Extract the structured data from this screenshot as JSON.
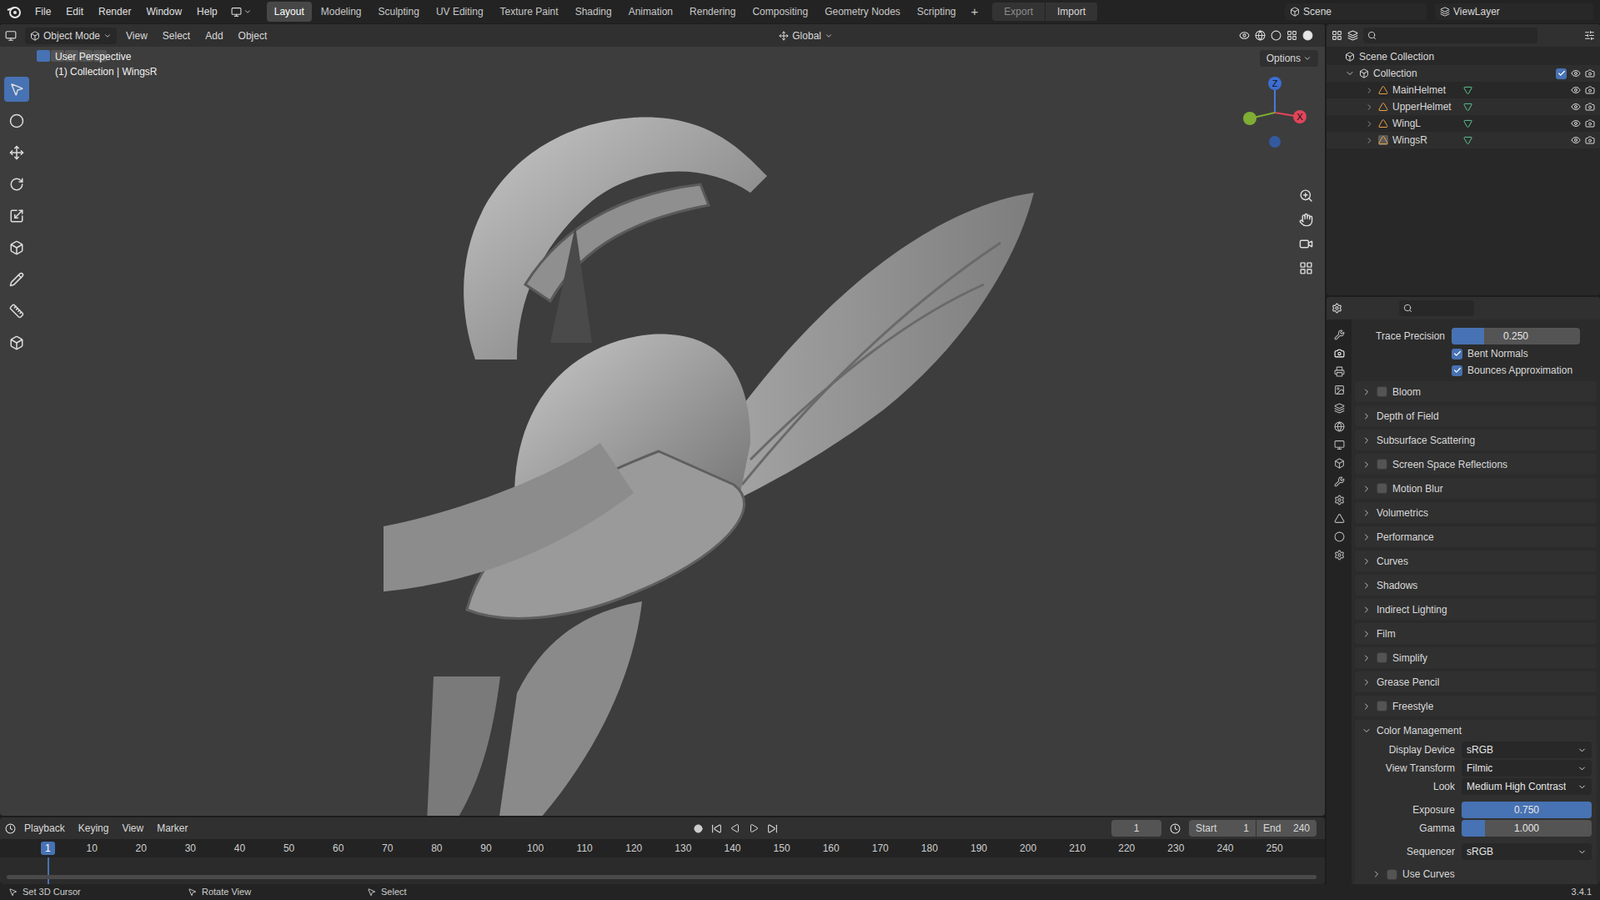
{
  "top_menu": [
    "File",
    "Edit",
    "Render",
    "Window",
    "Help"
  ],
  "workspaces": [
    {
      "label": "Layout",
      "selected": true
    },
    {
      "label": "Modeling",
      "selected": false
    },
    {
      "label": "Sculpting",
      "selected": false
    },
    {
      "label": "UV Editing",
      "selected": false
    },
    {
      "label": "Texture Paint",
      "selected": false
    },
    {
      "label": "Shading",
      "selected": false
    },
    {
      "label": "Animation",
      "selected": false
    },
    {
      "label": "Rendering",
      "selected": false
    },
    {
      "label": "Compositing",
      "selected": false
    },
    {
      "label": "Geometry Nodes",
      "selected": false
    },
    {
      "label": "Scripting",
      "selected": false
    }
  ],
  "add_workspace": "+",
  "io_buttons": [
    "Export",
    "Import"
  ],
  "scene": "Scene",
  "view_layer": "ViewLayer",
  "viewport": {
    "mode": "Object Mode",
    "menus": [
      "View",
      "Select",
      "Add",
      "Object"
    ],
    "orientation": "Global",
    "options": "Options",
    "perspective": "User Perspective",
    "context": "(1) Collection | WingsR",
    "gizmo_labels": [
      "Z",
      "X"
    ]
  },
  "outliner": {
    "root": "Scene Collection",
    "collection": {
      "name": "Collection",
      "checked": true,
      "expanded": true
    },
    "objects": [
      {
        "name": "MainHelmet",
        "active": false
      },
      {
        "name": "UpperHelmet",
        "active": false
      },
      {
        "name": "WingL",
        "active": false
      },
      {
        "name": "WingsR",
        "active": true
      }
    ]
  },
  "properties": {
    "top_rows": [
      {
        "kind": "slider",
        "label": "Trace Precision",
        "value": "0.250",
        "level": 0.25
      },
      {
        "kind": "checkbox",
        "label": "Bent Normals",
        "checked": true
      },
      {
        "kind": "checkbox",
        "label": "Bounces Approximation",
        "checked": true
      }
    ],
    "panels": [
      {
        "label": "Bloom",
        "has_checkbox": true,
        "checked": false,
        "expanded": false
      },
      {
        "label": "Depth of Field",
        "has_checkbox": false,
        "checked": false,
        "expanded": false
      },
      {
        "label": "Subsurface Scattering",
        "has_checkbox": false,
        "checked": false,
        "expanded": false
      },
      {
        "label": "Screen Space Reflections",
        "has_checkbox": true,
        "checked": false,
        "expanded": false
      },
      {
        "label": "Motion Blur",
        "has_checkbox": true,
        "checked": false,
        "expanded": false
      },
      {
        "label": "Volumetrics",
        "has_checkbox": false,
        "checked": false,
        "expanded": false
      },
      {
        "label": "Performance",
        "has_checkbox": false,
        "checked": false,
        "expanded": false
      },
      {
        "label": "Curves",
        "has_checkbox": false,
        "checked": false,
        "expanded": false
      },
      {
        "label": "Shadows",
        "has_checkbox": false,
        "checked": false,
        "expanded": false
      },
      {
        "label": "Indirect Lighting",
        "has_checkbox": false,
        "checked": false,
        "expanded": false
      },
      {
        "label": "Film",
        "has_checkbox": false,
        "checked": false,
        "expanded": false
      },
      {
        "label": "Simplify",
        "has_checkbox": true,
        "checked": false,
        "expanded": false
      },
      {
        "label": "Grease Pencil",
        "has_checkbox": false,
        "checked": false,
        "expanded": false
      },
      {
        "label": "Freestyle",
        "has_checkbox": true,
        "checked": false,
        "expanded": false
      }
    ],
    "color_management": {
      "label": "Color Management",
      "expanded": true,
      "fields": [
        {
          "kind": "dropdown",
          "label": "Display Device",
          "value": "sRGB"
        },
        {
          "kind": "dropdown",
          "label": "View Transform",
          "value": "Filmic"
        },
        {
          "kind": "dropdown",
          "label": "Look",
          "value": "Medium High Contrast"
        },
        {
          "kind": "slider",
          "label": "Exposure",
          "value": "0.750",
          "level": 1.0
        },
        {
          "kind": "slider",
          "label": "Gamma",
          "value": "1.000",
          "level": 0.18
        },
        {
          "kind": "dropdown",
          "label": "Sequencer",
          "value": "sRGB"
        }
      ],
      "subpanel": {
        "label": "Use Curves",
        "checked": false,
        "expanded": false
      }
    }
  },
  "timeline": {
    "menus": [
      "Playback",
      "Keying",
      "View",
      "Marker"
    ],
    "current_frame": "1",
    "start_label": "Start",
    "start": "1",
    "end_label": "End",
    "end": "240",
    "playhead": "1",
    "ticks": [
      "10",
      "20",
      "30",
      "40",
      "50",
      "60",
      "70",
      "80",
      "90",
      "100",
      "110",
      "120",
      "130",
      "140",
      "150",
      "160",
      "170",
      "180",
      "190",
      "200",
      "210",
      "220",
      "230",
      "240",
      "250"
    ]
  },
  "status_bar": {
    "hints": [
      "Set 3D Cursor",
      "Rotate View",
      "Select"
    ],
    "version": "3.4.1"
  }
}
